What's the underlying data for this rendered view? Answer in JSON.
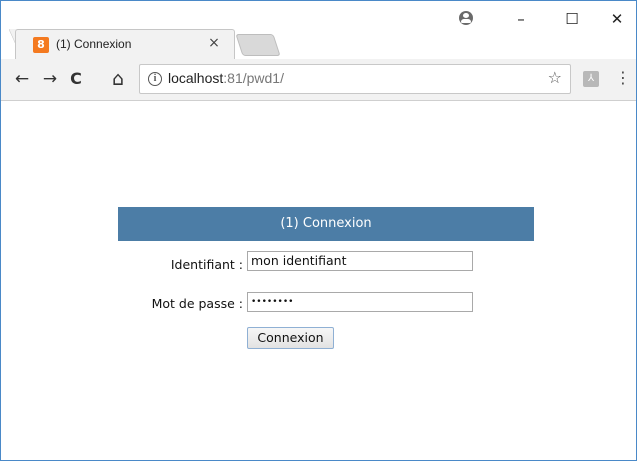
{
  "browser": {
    "tab_title": "(1) Connexion",
    "tab_close": "×",
    "favicon_glyph": "8",
    "window_controls": {
      "minimize": "–",
      "maximize": "☐",
      "close": "✕"
    },
    "nav": {
      "back": "←",
      "forward": "→",
      "reload": "C",
      "home": "⌂"
    },
    "url_host": "localhost",
    "url_rest": ":81/pwd1/",
    "info_glyph": "i",
    "star_glyph": "☆",
    "pdf_glyph": "⅄",
    "menu_glyph": "⋮"
  },
  "form": {
    "title": "(1) Connexion",
    "username_label": "Identifiant :",
    "username_value": "mon identifiant",
    "password_label": "Mot de passe :",
    "password_value": "••••••••",
    "submit_label": "Connexion"
  },
  "colors": {
    "header_bg": "#4c7da6",
    "favicon_bg": "#f47a20",
    "window_border": "#4a89c8"
  }
}
